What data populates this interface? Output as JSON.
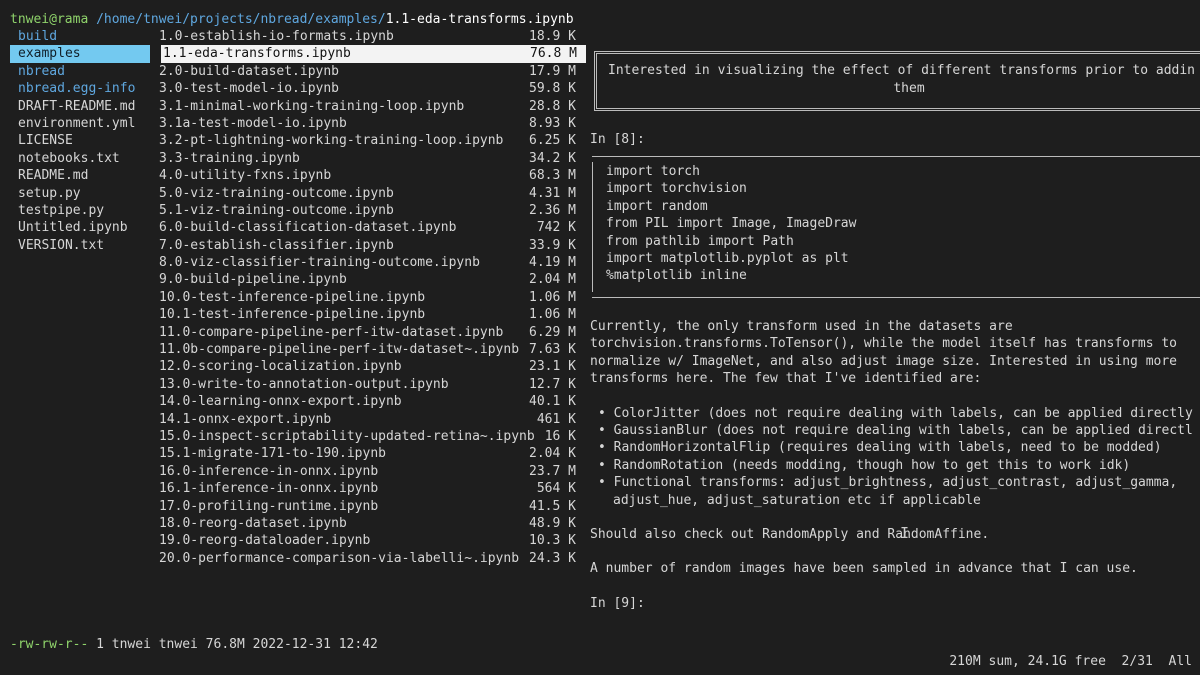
{
  "title": {
    "user_host": "tnwei@rama",
    "path": " /home/tnwei/projects/nbread/examples/",
    "file": "1.1-eda-transforms.ipynb"
  },
  "parent_column": [
    {
      "name": "build",
      "type": "dir"
    },
    {
      "name": "examples",
      "type": "dir-selected"
    },
    {
      "name": "nbread",
      "type": "dir"
    },
    {
      "name": "nbread.egg-info",
      "type": "dir"
    },
    {
      "name": "DRAFT-README.md",
      "type": "file"
    },
    {
      "name": "environment.yml",
      "type": "file"
    },
    {
      "name": "LICENSE",
      "type": "file"
    },
    {
      "name": "notebooks.txt",
      "type": "file"
    },
    {
      "name": "README.md",
      "type": "file"
    },
    {
      "name": "setup.py",
      "type": "file"
    },
    {
      "name": "testpipe.py",
      "type": "file"
    },
    {
      "name": "Untitled.ipynb",
      "type": "file"
    },
    {
      "name": "VERSION.txt",
      "type": "file"
    }
  ],
  "files": [
    {
      "name": "1.0-establish-io-formats.ipynb",
      "size": "18.9 K"
    },
    {
      "name": "1.1-eda-transforms.ipynb",
      "size": "76.8 M",
      "selected": true
    },
    {
      "name": "2.0-build-dataset.ipynb",
      "size": "17.9 M"
    },
    {
      "name": "3.0-test-model-io.ipynb",
      "size": "59.8 K"
    },
    {
      "name": "3.1-minimal-working-training-loop.ipynb",
      "size": "28.8 K"
    },
    {
      "name": "3.1a-test-model-io.ipynb",
      "size": "8.93 K"
    },
    {
      "name": "3.2-pt-lightning-working-training-loop.ipynb",
      "size": "6.25 K"
    },
    {
      "name": "3.3-training.ipynb",
      "size": "34.2 K"
    },
    {
      "name": "4.0-utility-fxns.ipynb",
      "size": "68.3 M"
    },
    {
      "name": "5.0-viz-training-outcome.ipynb",
      "size": "4.31 M"
    },
    {
      "name": "5.1-viz-training-outcome.ipynb",
      "size": "2.36 M"
    },
    {
      "name": "6.0-build-classification-dataset.ipynb",
      "size": "742 K"
    },
    {
      "name": "7.0-establish-classifier.ipynb",
      "size": "33.9 K"
    },
    {
      "name": "8.0-viz-classifier-training-outcome.ipynb",
      "size": "4.19 M"
    },
    {
      "name": "9.0-build-pipeline.ipynb",
      "size": "2.04 M"
    },
    {
      "name": "10.0-test-inference-pipeline.ipynb",
      "size": "1.06 M"
    },
    {
      "name": "10.1-test-inference-pipeline.ipynb",
      "size": "1.06 M"
    },
    {
      "name": "11.0-compare-pipeline-perf-itw-dataset.ipynb",
      "size": "6.29 M"
    },
    {
      "name": "11.0b-compare-pipeline-perf-itw-dataset~.ipynb",
      "size": "7.63 K"
    },
    {
      "name": "12.0-scoring-localization.ipynb",
      "size": "23.1 K"
    },
    {
      "name": "13.0-write-to-annotation-output.ipynb",
      "size": "12.7 K"
    },
    {
      "name": "14.0-learning-onnx-export.ipynb",
      "size": "40.1 K"
    },
    {
      "name": "14.1-onnx-export.ipynb",
      "size": "461 K"
    },
    {
      "name": "15.0-inspect-scriptability-updated-retina~.ipynb",
      "size": "16 K"
    },
    {
      "name": "15.1-migrate-171-to-190.ipynb",
      "size": "2.04 K"
    },
    {
      "name": "16.0-inference-in-onnx.ipynb",
      "size": "23.7 M"
    },
    {
      "name": "16.1-inference-in-onnx.ipynb",
      "size": "564 K"
    },
    {
      "name": "17.0-profiling-runtime.ipynb",
      "size": "41.5 K"
    },
    {
      "name": "18.0-reorg-dataset.ipynb",
      "size": "48.9 K"
    },
    {
      "name": "19.0-reorg-dataloader.ipynb",
      "size": "10.3 K"
    },
    {
      "name": "20.0-performance-comparison-via-labelli~.ipynb",
      "size": "24.3 K"
    }
  ],
  "preview": {
    "md_line1": "Interested in visualizing the effect of different transforms prior to addin",
    "md_line2": "them",
    "prompt8": "In [8]:",
    "code": [
      "import torch",
      "import torchvision",
      "import random",
      "from PIL import Image, ImageDraw",
      "from pathlib import Path",
      "import matplotlib.pyplot as plt",
      "%matplotlib inline"
    ],
    "para": [
      "Currently, the only transform used in the datasets are",
      "torchvision.transforms.ToTensor(), while the model itself has transforms to",
      "normalize w/ ImageNet, and also adjust image size. Interested in using more",
      "transforms here. The few that I've identified are:"
    ],
    "bullets": [
      "• ColorJitter (does not require dealing with labels, can be applied directly",
      "• GaussianBlur (does not require dealing with labels, can be applied directl",
      "• RandomHorizontalFlip (requires dealing with labels, need to be modded)",
      "• RandomRotation (needs modding, though how to get this to work idk)",
      "• Functional transforms: adjust_brightness, adjust_contrast, adjust_gamma,"
    ],
    "bullet_cont": "adjust_hue, adjust_saturation etc if applicable",
    "also": "Should also check out RandomApply and RandomAffine.",
    "sampled": "A number of random images have been sampled in advance that I can use.",
    "prompt9": "In [9]:"
  },
  "status": {
    "perm": "-rw-rw-r--",
    "info": " 1 tnwei tnwei 76.8M 2022-12-31 12:42",
    "right": "210M sum, 24.1G free  2/31  All"
  }
}
